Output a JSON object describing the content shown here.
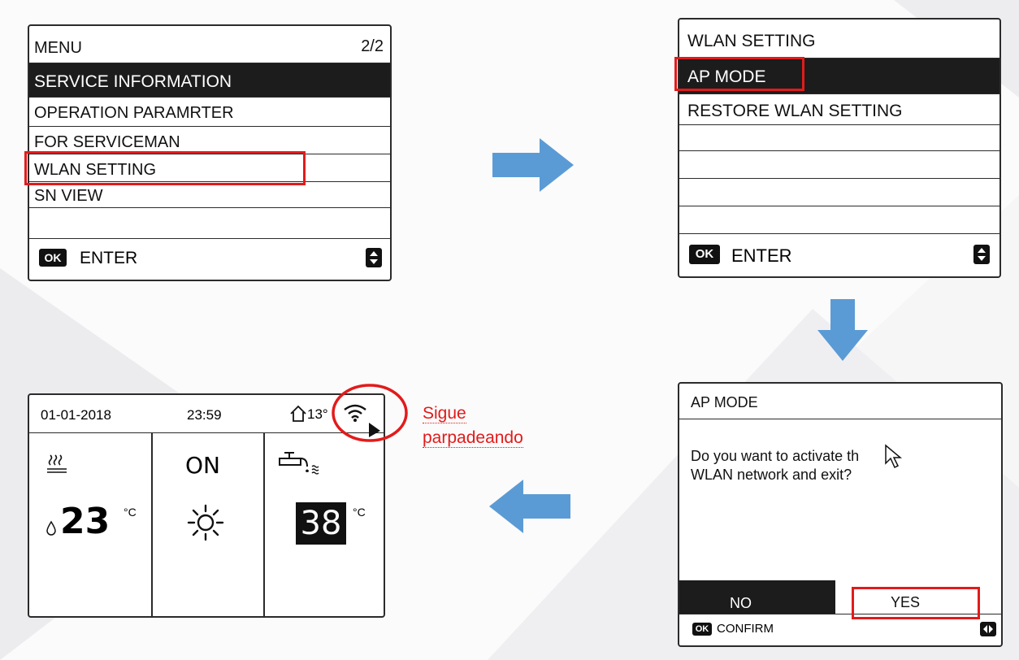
{
  "colors": {
    "accent_red": "#e21b1b",
    "arrow_blue": "#5b9bd5",
    "selection": "#1c1c1c"
  },
  "menu_panel": {
    "title": "MENU",
    "page": "2/2",
    "items": [
      {
        "label": "SERVICE INFORMATION"
      },
      {
        "label": "OPERATION PARAMRTER"
      },
      {
        "label": "FOR SERVICEMAN"
      },
      {
        "label": "WLAN SETTING"
      },
      {
        "label": "SN VIEW"
      }
    ],
    "ok_label": "OK",
    "enter_label": "ENTER"
  },
  "wlan_panel": {
    "title": "WLAN SETTING",
    "items": [
      {
        "label": "AP MODE"
      },
      {
        "label": "RESTORE WLAN SETTING"
      }
    ],
    "ok_label": "OK",
    "enter_label": "ENTER"
  },
  "ap_panel": {
    "title": "AP MODE",
    "question_line1": "Do you want to activate th",
    "question_line2": "WLAN network and exit?",
    "no_label": "NO",
    "yes_label": "YES",
    "ok_label": "OK",
    "confirm_label": "CONFIRM"
  },
  "home_panel": {
    "date": "01-01-2018",
    "time": "23:59",
    "outdoor_temp": "13°",
    "heating_temp": "23",
    "heating_unit": "°C",
    "status": "ON",
    "water_temp": "38",
    "water_unit": "°C"
  },
  "annotation": {
    "line1": "Sigue",
    "line2": "parpadeando"
  }
}
